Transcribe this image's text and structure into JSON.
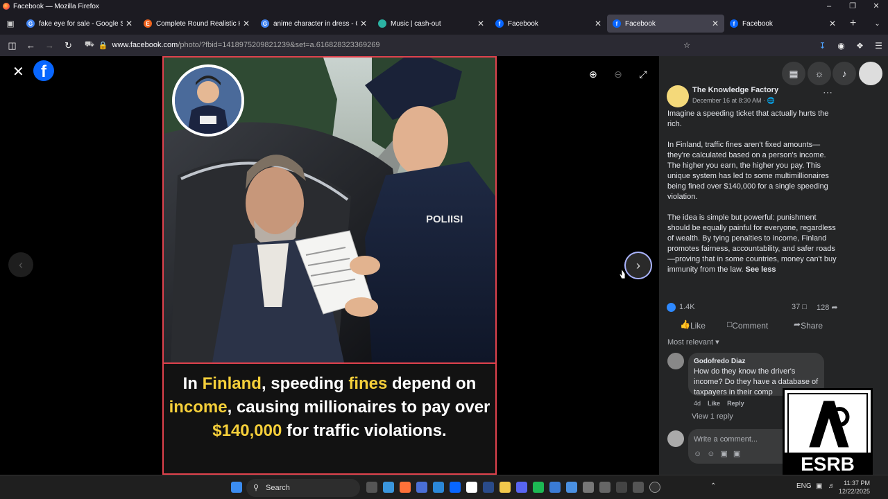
{
  "window": {
    "title": "Facebook — Mozilla Firefox"
  },
  "tabs": [
    {
      "label": "fake eye for sale - Google Search",
      "favicon_color": "#4285f4",
      "favicon_letter": "G"
    },
    {
      "label": "Complete Round Realistic Human Eye",
      "favicon_color": "#f1641e",
      "favicon_letter": "E"
    },
    {
      "label": "anime character in dress - Google Search",
      "favicon_color": "#4285f4",
      "favicon_letter": "G"
    },
    {
      "label": "Music | cash-out",
      "favicon_color": "#2bb3a3",
      "favicon_letter": ""
    },
    {
      "label": "Facebook",
      "favicon_color": "#0866ff",
      "favicon_letter": "f"
    },
    {
      "label": "Facebook",
      "favicon_color": "#0866ff",
      "favicon_letter": "f",
      "active": true
    },
    {
      "label": "Facebook",
      "favicon_color": "#0866ff",
      "favicon_letter": "f"
    }
  ],
  "url": {
    "host": "www.facebook.com",
    "path": "/photo/?fbid=1418975209821239&set=a.616828323369269"
  },
  "photo": {
    "caption_parts": [
      {
        "t": "In ",
        "hl": false
      },
      {
        "t": "Finland",
        "hl": true
      },
      {
        "t": ", speeding ",
        "hl": false
      },
      {
        "t": "fines",
        "hl": true
      },
      {
        "t": " depend on ",
        "hl": false
      },
      {
        "t": "income",
        "hl": true
      },
      {
        "t": ", causing millionaires to pay over ",
        "hl": false
      },
      {
        "t": "$140,000",
        "hl": true
      },
      {
        "t": " for traffic violations.",
        "hl": false
      }
    ],
    "ticket_label": "POLIISI",
    "accent_color": "#f5cf3a"
  },
  "post": {
    "page_name": "The Knowledge Factory",
    "date": "December 16 at 8:30 AM · ",
    "paragraphs": [
      "Imagine a speeding ticket that actually hurts the rich.",
      "In Finland, traffic fines aren't fixed amounts—they're calculated based on a person's income. The higher you earn, the higher you pay. This unique system has led to some multimillionaires being fined over $140,000 for a single speeding violation.",
      "The idea is simple but powerful: punishment should be equally painful for everyone, regardless of wealth. By tying penalties to income, Finland promotes fairness, accountability, and safer roads—proving that in some countries, money can't buy immunity from the law."
    ],
    "see_less": "See less",
    "reactions": "1.4K",
    "comments_count": "37",
    "shares_count": "128",
    "like_label": "Like",
    "comment_label": "Comment",
    "share_label": "Share",
    "sort_label": "Most relevant"
  },
  "comment": {
    "author": "Godofredo Diaz",
    "text": "How do they know the driver's income? Do they have a database of taxpayers in their comp",
    "time": "4d",
    "like": "Like",
    "reply": "Reply",
    "view_replies": "View 1 reply"
  },
  "composer": {
    "placeholder": "Write a comment..."
  },
  "esrb": {
    "label": "ESRB"
  },
  "taskbar": {
    "search": "Search",
    "lang": "ENG",
    "time": "11:37 PM",
    "date": "12/22/2025"
  }
}
